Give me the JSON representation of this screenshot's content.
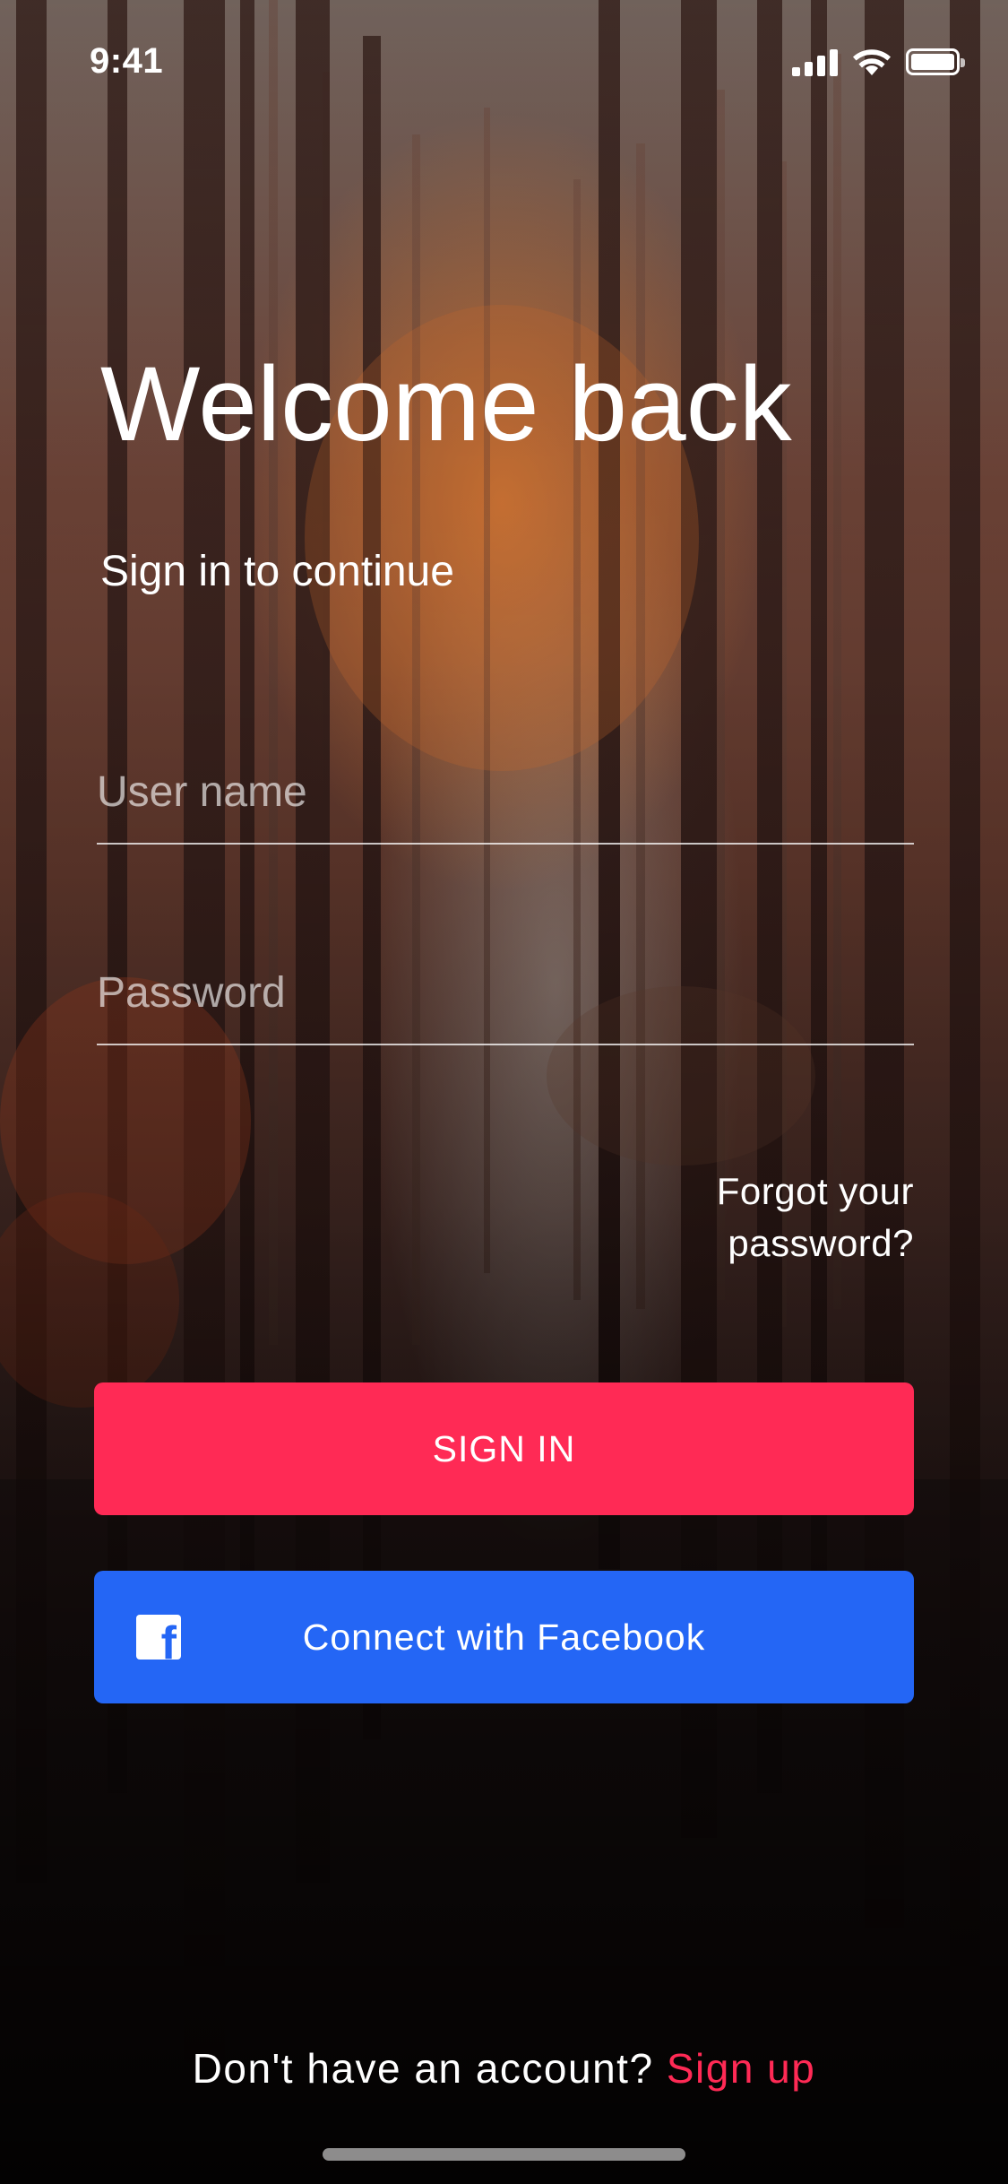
{
  "status_bar": {
    "time": "9:41",
    "icons": [
      "cellular-signal-icon",
      "wifi-icon",
      "battery-icon"
    ]
  },
  "header": {
    "title": "Welcome back",
    "subtitle": "Sign in to continue"
  },
  "form": {
    "username": {
      "placeholder": "User name",
      "value": ""
    },
    "password": {
      "placeholder": "Password",
      "value": ""
    },
    "forgot_line1": "Forgot your",
    "forgot_line2": "password?"
  },
  "buttons": {
    "signin_label": "SIGN IN",
    "facebook_label": "Connect with Facebook",
    "facebook_icon": "facebook-icon"
  },
  "footer": {
    "prompt": "Don't have an account?",
    "signup_label": "Sign up"
  },
  "colors": {
    "signin_button": "#ff2a55",
    "facebook_button": "#2466f5",
    "signup_link": "#ff2a55"
  }
}
